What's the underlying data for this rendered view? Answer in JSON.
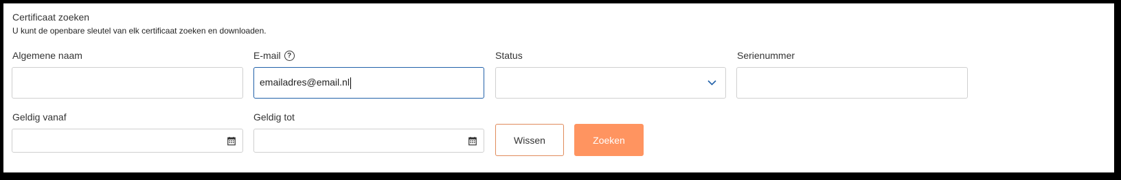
{
  "header": {
    "title": "Certificaat zoeken",
    "subtitle": "U kunt de openbare sleutel van elk certificaat zoeken en downloaden."
  },
  "fields": {
    "common_name": {
      "label": "Algemene naam",
      "value": ""
    },
    "email": {
      "label": "E-mail",
      "value": "emailadres@email.nl",
      "help_icon": "help-circle-icon"
    },
    "status": {
      "label": "Status",
      "selected": "",
      "icon": "chevron-down-icon"
    },
    "serial_number": {
      "label": "Serienummer",
      "value": ""
    },
    "valid_from": {
      "label": "Geldig vanaf",
      "value": "",
      "icon": "calendar-icon"
    },
    "valid_to": {
      "label": "Geldig tot",
      "value": "",
      "icon": "calendar-icon"
    }
  },
  "buttons": {
    "clear_label": "Wissen",
    "search_label": "Zoeken"
  },
  "colors": {
    "accent": "#ff9460",
    "focus_border": "#1f5fa8",
    "chevron": "#1f5fa8"
  }
}
